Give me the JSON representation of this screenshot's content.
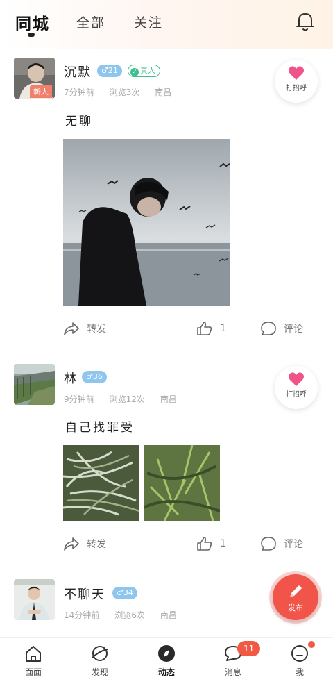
{
  "tabs": [
    {
      "label": "同城",
      "active": true
    },
    {
      "label": "全部",
      "active": false
    },
    {
      "label": "关注",
      "active": false
    }
  ],
  "header_icons": {
    "bell": "bell-icon"
  },
  "posts": [
    {
      "username": "沉默",
      "gender_age": "♂21",
      "verified_label": "真人",
      "new_tag": "新人",
      "meta": {
        "time": "7分钟前",
        "views": "浏览3次",
        "city": "南昌"
      },
      "greet_label": "打招呼",
      "content": "无聊",
      "actions": {
        "forward": "转发",
        "likes": "1",
        "comment": "评论"
      }
    },
    {
      "username": "林",
      "gender_age": "♂36",
      "meta": {
        "time": "9分钟前",
        "views": "浏览12次",
        "city": "南昌"
      },
      "greet_label": "打招呼",
      "content": "自己找罪受",
      "actions": {
        "forward": "转发",
        "likes": "1",
        "comment": "评论"
      }
    },
    {
      "username": "不聊天",
      "gender_age": "♂34",
      "meta": {
        "time": "14分钟前",
        "views": "浏览6次",
        "city": "南昌"
      }
    }
  ],
  "fab": {
    "label": "发布"
  },
  "bottom_nav": [
    {
      "label": "面面",
      "icon": "home-icon"
    },
    {
      "label": "发现",
      "icon": "planet-icon"
    },
    {
      "label": "动态",
      "icon": "compass-icon",
      "active": true
    },
    {
      "label": "消息",
      "icon": "chat-bubble-icon",
      "badge": "11"
    },
    {
      "label": "我",
      "icon": "profile-icon",
      "dot": true
    }
  ],
  "colors": {
    "accent": "#f1554a",
    "heart": "#f0528a",
    "gender_badge": "#8ec6ee",
    "verified": "#3dbf8f"
  }
}
